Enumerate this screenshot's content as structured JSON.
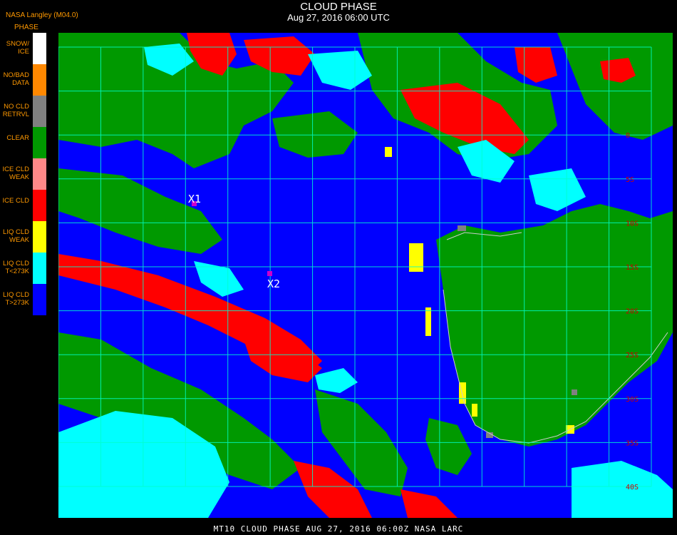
{
  "header": {
    "title": "CLOUD PHASE",
    "subtitle": "Aug 27, 2016 06:00 UTC",
    "provider": "NASA Langley (M04.0)"
  },
  "legend": {
    "title": "PHASE",
    "items": [
      {
        "label": "SNOW/\nICE",
        "color": "#ffffff"
      },
      {
        "label": "NO/BAD\nDATA",
        "color": "#ff8800"
      },
      {
        "label": "NO CLD\nRETRVL",
        "color": "#808080"
      },
      {
        "label": "CLEAR",
        "color": "#009900"
      },
      {
        "label": "ICE CLD\nWEAK",
        "color": "#ff8888"
      },
      {
        "label": "ICE CLD",
        "color": "#ff0000"
      },
      {
        "label": "LIQ CLD\nWEAK",
        "color": "#ffff00"
      },
      {
        "label": "LIQ CLD\nT<273K",
        "color": "#00ffff"
      },
      {
        "label": "LIQ CLD\nT>273K",
        "color": "#0000ff"
      }
    ]
  },
  "map": {
    "grid_color": "#00ffcc",
    "lat_labels": [
      "0",
      "5S",
      "10S",
      "15S",
      "20S",
      "25S",
      "30S",
      "35S",
      "40S"
    ],
    "label_color": "#cc0000",
    "markers": [
      {
        "label": "X1",
        "color": "#cc00cc"
      },
      {
        "label": "X2",
        "color": "#cc00cc"
      }
    ]
  },
  "footer": {
    "text": "MT10  CLOUD PHASE   AUG 27, 2016 06:00Z   NASA LARC"
  }
}
